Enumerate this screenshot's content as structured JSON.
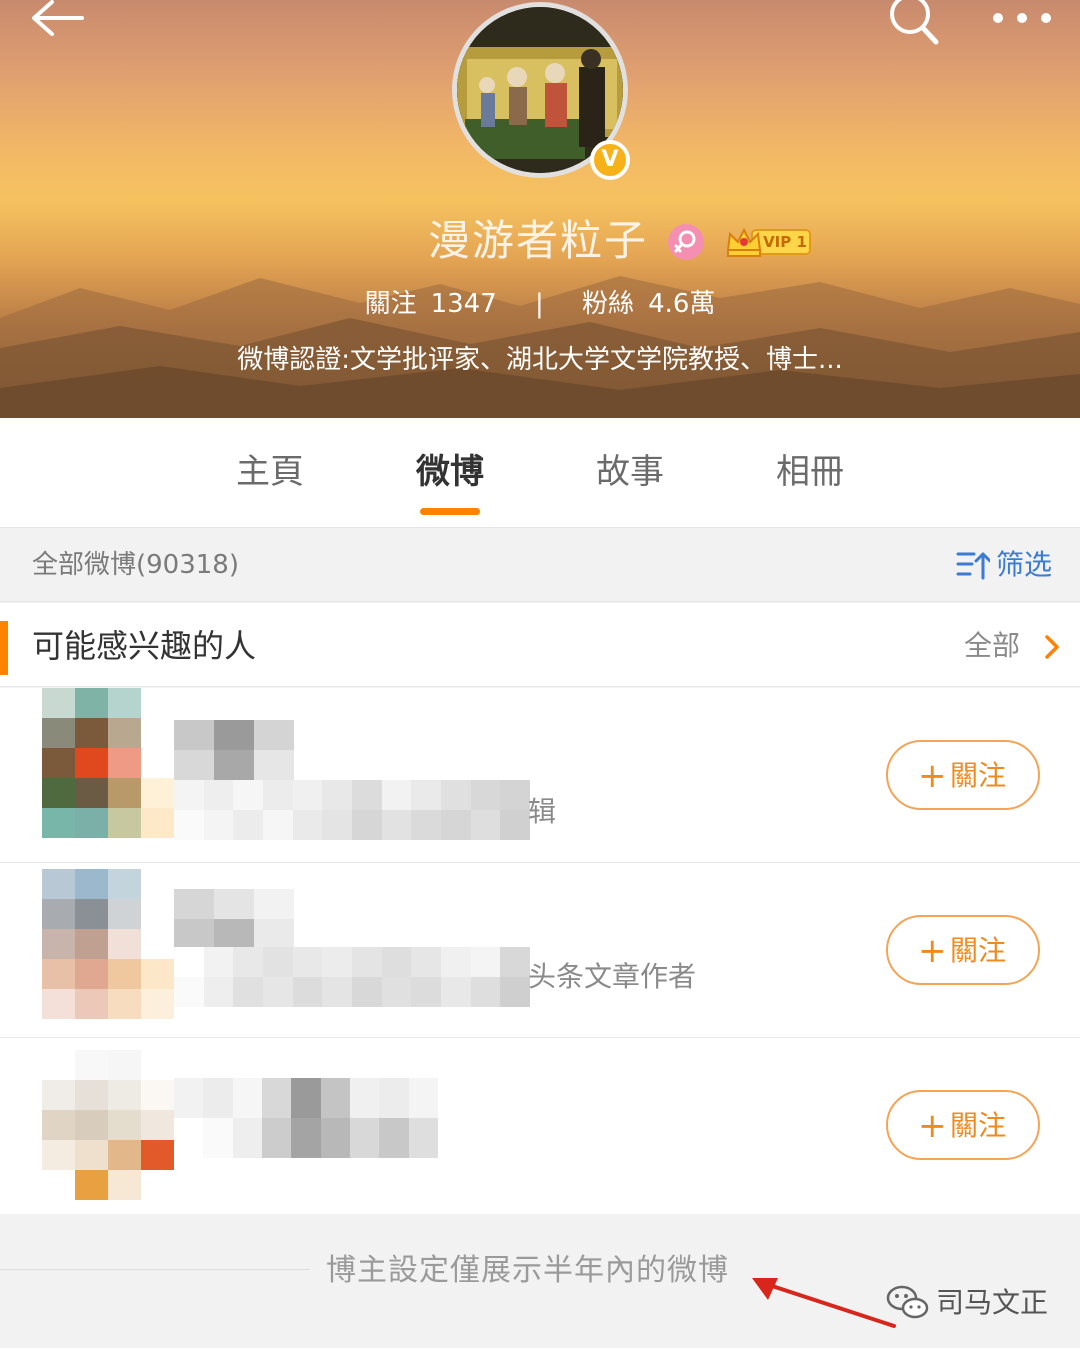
{
  "header": {
    "username": "漫游者粒子",
    "vip_label": "VIP 1",
    "verified_mark": "V",
    "stats": {
      "following_label": "關注",
      "following_count": "1347",
      "separator": "|",
      "fans_label": "粉絲",
      "fans_count": "4.6萬"
    },
    "verification": "微博認證:文学批评家、湖北大学文学院教授、博士..."
  },
  "tabs": [
    {
      "label": "主頁",
      "active": false
    },
    {
      "label": "微博",
      "active": true
    },
    {
      "label": "故事",
      "active": false
    },
    {
      "label": "相冊",
      "active": false
    }
  ],
  "filter_bar": {
    "all_weibo": "全部微博(90318)",
    "filter_label": "筛选"
  },
  "suggestions": {
    "title": "可能感兴趣的人",
    "see_all": "全部",
    "people": [
      {
        "desc_visible": "辑",
        "follow_label": "關注",
        "follow_plus": "+"
      },
      {
        "desc_visible": "头条文章作者",
        "follow_label": "關注",
        "follow_plus": "+"
      },
      {
        "desc_visible": "",
        "follow_label": "關注",
        "follow_plus": "+"
      }
    ]
  },
  "notice": {
    "text": "博主設定僅展示半年內的微博"
  },
  "watermark": {
    "text": "司马文正"
  },
  "colors": {
    "accent": "#ff8200",
    "follow": "#f08a1e",
    "filter_blue": "#3b7bd3"
  }
}
